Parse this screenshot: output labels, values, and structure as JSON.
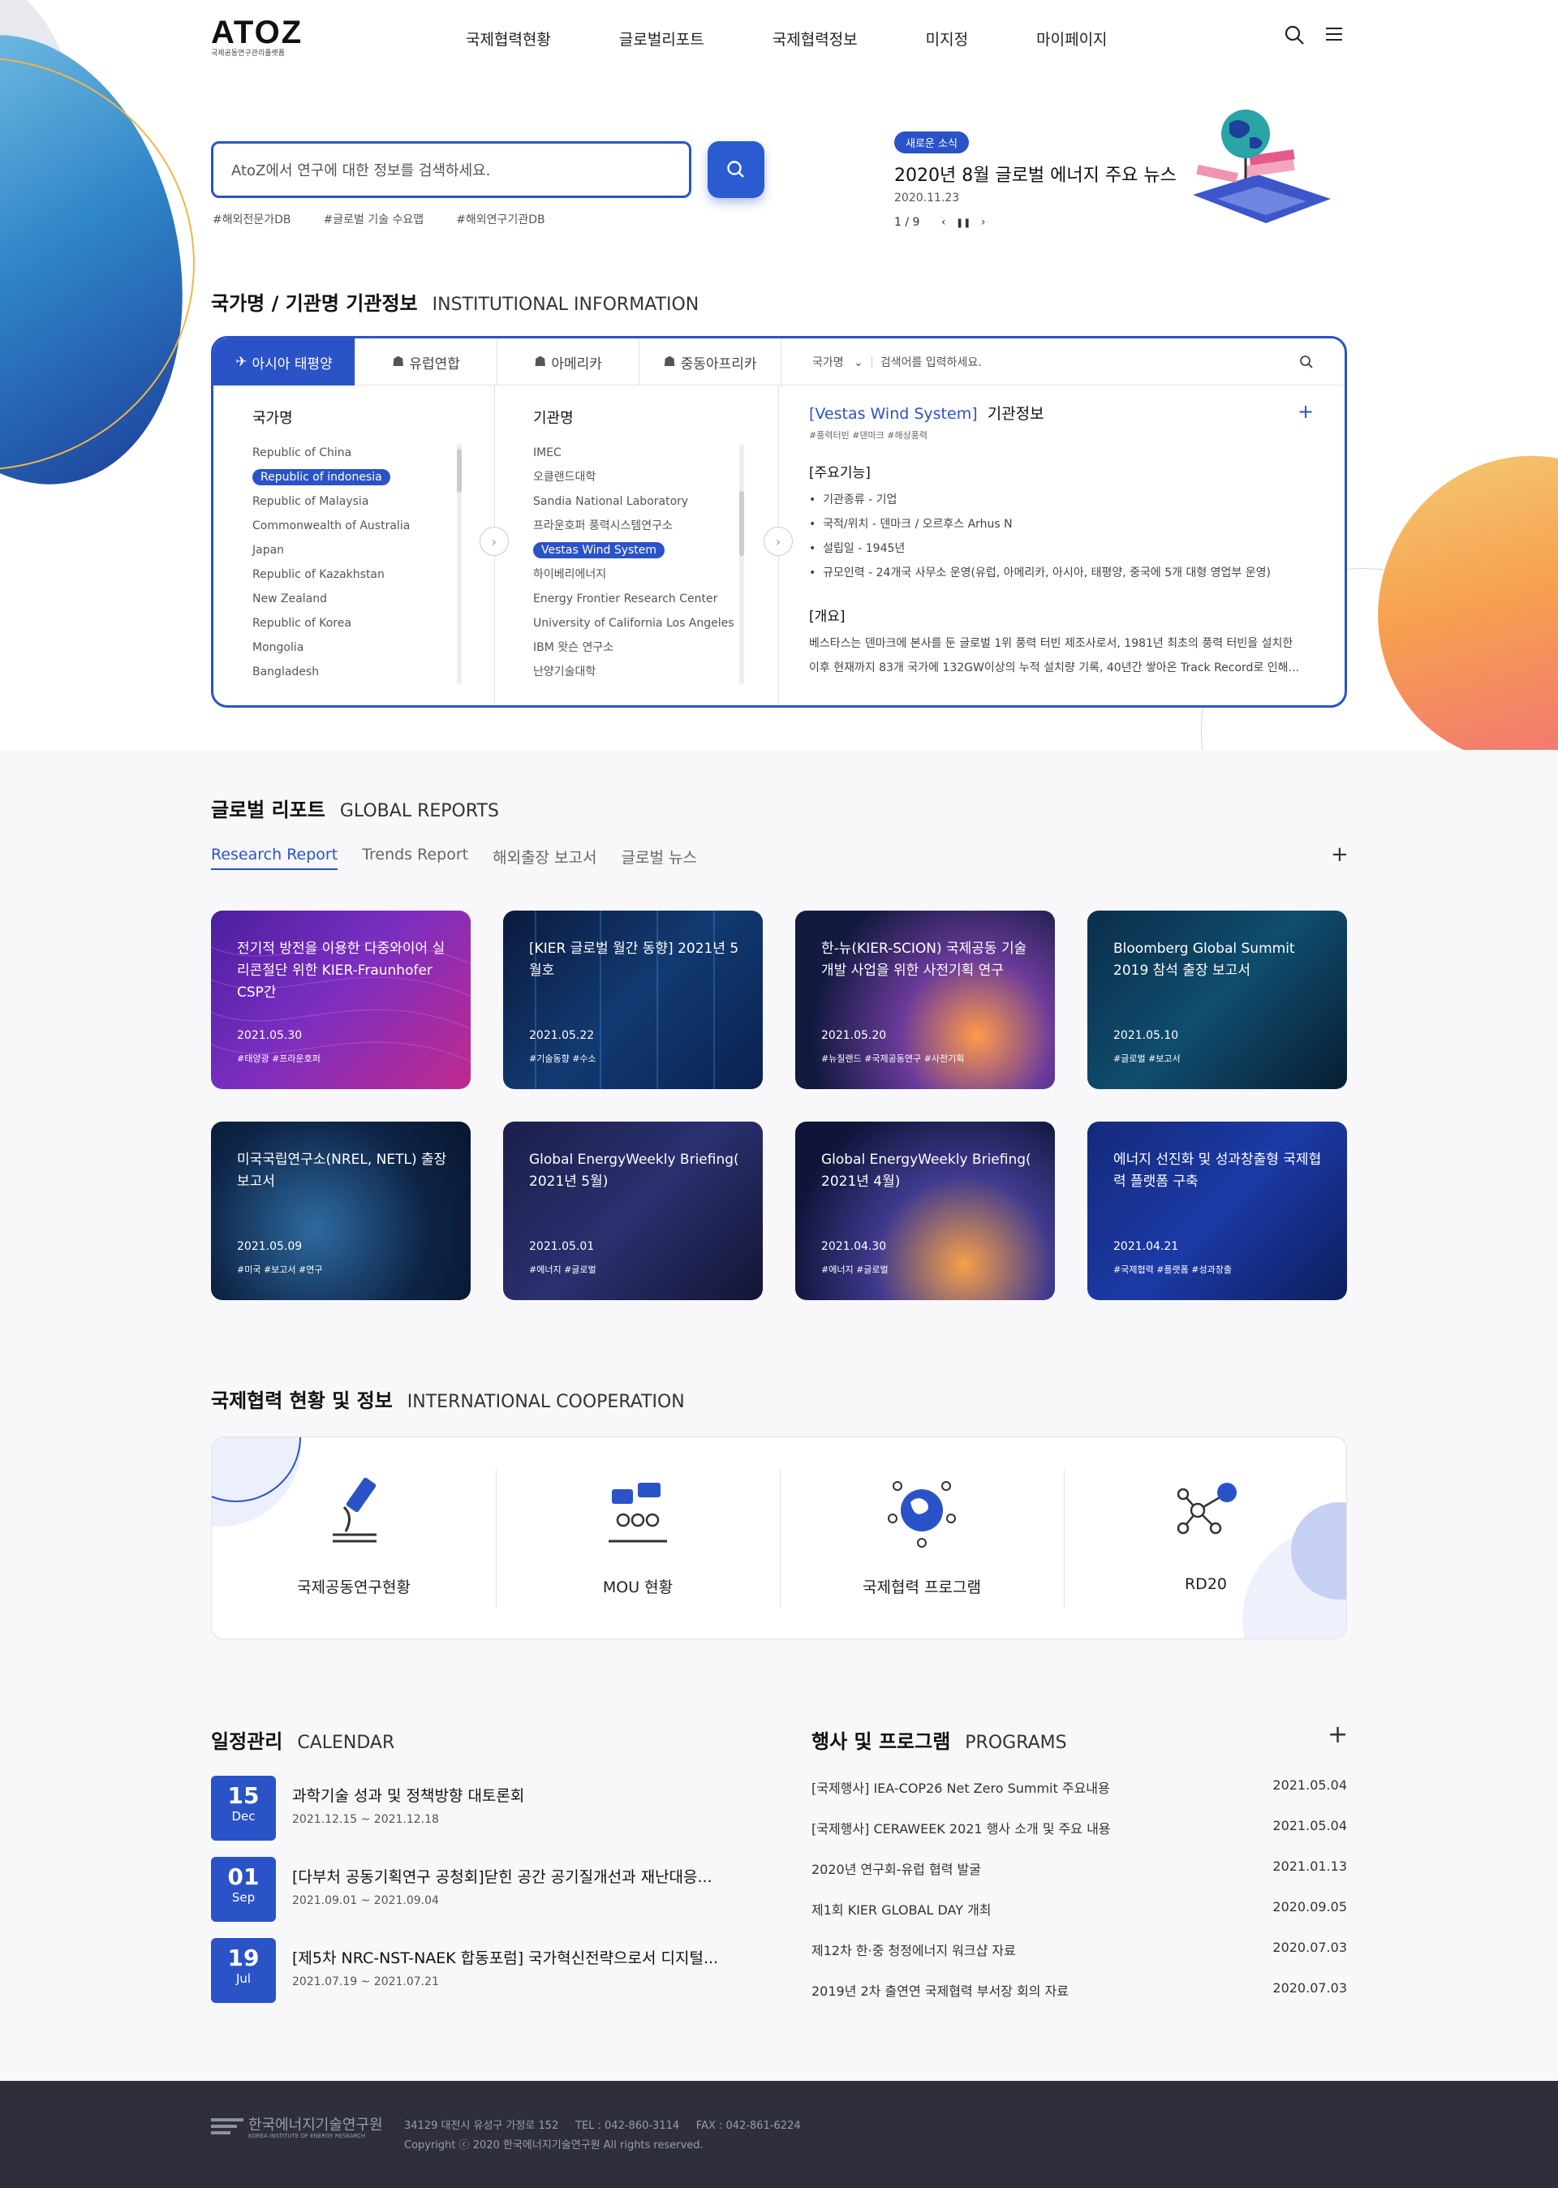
{
  "header": {
    "logo": "ATOZ",
    "logo_sub": "국제공동연구관리플랫폼",
    "nav": [
      "국제협력현황",
      "글로벌리포트",
      "국제협력정보",
      "미지정",
      "마이페이지"
    ]
  },
  "search": {
    "placeholder": "AtoZ에서 연구에 대한 정보를 검색하세요.",
    "tags": [
      "#해외전문가DB",
      "#글로벌 기술 수요맵",
      "#해외연구기관DB"
    ]
  },
  "news": {
    "badge": "새로운 소식",
    "title": "2020년 8월 글로벌 에너지 주요 뉴스",
    "date": "2020.11.23",
    "page": "1 / 9"
  },
  "institution": {
    "title": "국가명 / 기관명 기관정보",
    "title_en": "INSTITUTIONAL INFORMATION",
    "tabs": [
      "아시아 태평양",
      "유럽연합",
      "아메리카",
      "중동아프리카"
    ],
    "search_select": "국가명",
    "search_placeholder": "검색어를 입력하세요.",
    "country_head": "국가명",
    "countries": [
      "Republic of China",
      "Republic of indonesia",
      "Republic of Malaysia",
      "Commonwealth of Australia",
      "Japan",
      "Republic of Kazakhstan",
      "New Zealand",
      "Republic of Korea",
      "Mongolia",
      "Bangladesh"
    ],
    "org_head": "기관명",
    "orgs": [
      "IMEC",
      "오클랜드대학",
      "Sandia National Laboratory",
      "프라운호퍼 풍력시스템연구소",
      "Vestas Wind System",
      "하이베리에너지",
      "Energy Frontier Research Center",
      "University of California Los Angeles",
      "IBM 왓슨 연구소",
      "난양기술대학"
    ],
    "info_name": "[Vestas Wind System]",
    "info_title": "기관정보",
    "info_tags": "#풍력터빈  #덴마크  #해상풍력",
    "section1": "[주요기능]",
    "items": [
      "기관종류 - 기업",
      "국적/위치 - 덴마크 / 오르후스 Arhus N",
      "설립일 - 1945년",
      "규모인력 - 24개국 사무소 운영(유럽, 아메리카, 아시아, 태평양, 중국에 5개 대형 영업부 운영)"
    ],
    "section2": "[개요]",
    "summary": "베스타스는 덴마크에 본사를 둔 글로벌 1위 풍력 터빈 제조사로서, 1981년 최초의 풍력 터빈을 설치한 이후 현재까지 83개 국가에 132GW이상의 누적 설치량 기록, 40년간 쌓아온 Track Record로 인해..."
  },
  "reports": {
    "title": "글로벌 리포트",
    "title_en": "GLOBAL REPORTS",
    "tabs": [
      "Research Report",
      "Trends Report",
      "해외출장 보고서",
      "글로벌 뉴스"
    ],
    "cards": [
      {
        "title": "전기적 방전을 이용한 다중와이어 실리콘절단 위한 KIER-Fraunhofer CSP간",
        "date": "2021.05.30",
        "tags": "#태양광 #프라운호퍼"
      },
      {
        "title": "[KIER 글로벌 월간 동향] 2021년 5월호",
        "date": "2021.05.22",
        "tags": "#기술동향 #수소"
      },
      {
        "title": "한-뉴(KIER-SCION) 국제공동 기술개발 사업을 위한 사전기획 연구",
        "date": "2021.05.20",
        "tags": "#뉴질랜드 #국제공동연구 #사전기획"
      },
      {
        "title": "Bloomberg Global Summit 2019 참석 출장 보고서",
        "date": "2021.05.10",
        "tags": "#글로벌 #보고서"
      },
      {
        "title": "미국국립연구소(NREL, NETL) 출장 보고서",
        "date": "2021.05.09",
        "tags": "#미국 #보고서 #연구"
      },
      {
        "title": "Global EnergyWeekly Briefing( 2021년 5월)",
        "date": "2021.05.01",
        "tags": "#에너지 #글로벌"
      },
      {
        "title": "Global EnergyWeekly Briefing( 2021년 4월)",
        "date": "2021.04.30",
        "tags": "#에너지 #글로벌"
      },
      {
        "title": "에너지 선진화 및 성과창출형 국제협력 플랫폼 구축",
        "date": "2021.04.21",
        "tags": "#국제협력 #플랫폼 #성과창출"
      }
    ]
  },
  "coop": {
    "title": "국제협력 현황 및 정보",
    "title_en": "INTERNATIONAL COOPERATION",
    "items": [
      "국제공동연구현황",
      "MOU 현황",
      "국제협력 프로그램",
      "RD20"
    ]
  },
  "calendar": {
    "title": "일정관리",
    "title_en": "CALENDAR",
    "events": [
      {
        "day": "15",
        "month": "Dec",
        "title": "과학기술 성과 및 정책방향 대토론회",
        "range": "2021.12.15 ~ 2021.12.18"
      },
      {
        "day": "01",
        "month": "Sep",
        "title": "[다부처 공동기획연구 공청회]닫힌 공간 공기질개선과 재난대응...",
        "range": "2021.09.01 ~ 2021.09.04"
      },
      {
        "day": "19",
        "month": "Jul",
        "title": "[제5차 NRC-NST-NAEK 합동포럼] 국가혁신전략으로서 디지털...",
        "range": "2021.07.19 ~ 2021.07.21"
      }
    ]
  },
  "programs": {
    "title": "행사 및 프로그램",
    "title_en": "PROGRAMS",
    "items": [
      {
        "title": "[국제행사] IEA-COP26 Net Zero Summit 주요내용",
        "date": "2021.05.04"
      },
      {
        "title": "[국제행사] CERAWEEK 2021 행사 소개 및 주요 내용",
        "date": "2021.05.04"
      },
      {
        "title": "2020년 연구회-유럽 협력 발굴",
        "date": "2021.01.13"
      },
      {
        "title": "제1회 KIER GLOBAL DAY 개최",
        "date": "2020.09.05"
      },
      {
        "title": "제12차 한·중 청정에너지 워크샵 자료",
        "date": "2020.07.03"
      },
      {
        "title": "2019년 2차 출연연 국제협력 부서장 회의 자료",
        "date": "2020.07.03"
      }
    ]
  },
  "footer": {
    "org": "한국에너지기술연구원",
    "org_en": "KOREA INSTITUTE OF ENERGY RESEARCH",
    "address": "34129 대전시 유성구 가정로 152     TEL : 042-860-3114     FAX : 042-861-6224",
    "copyright": "Copyright ⓒ 2020 한국에너지기술연구원 All rights reserved."
  },
  "colors": {
    "accent": "#2a53c8",
    "footer": "#2e2f3b"
  }
}
